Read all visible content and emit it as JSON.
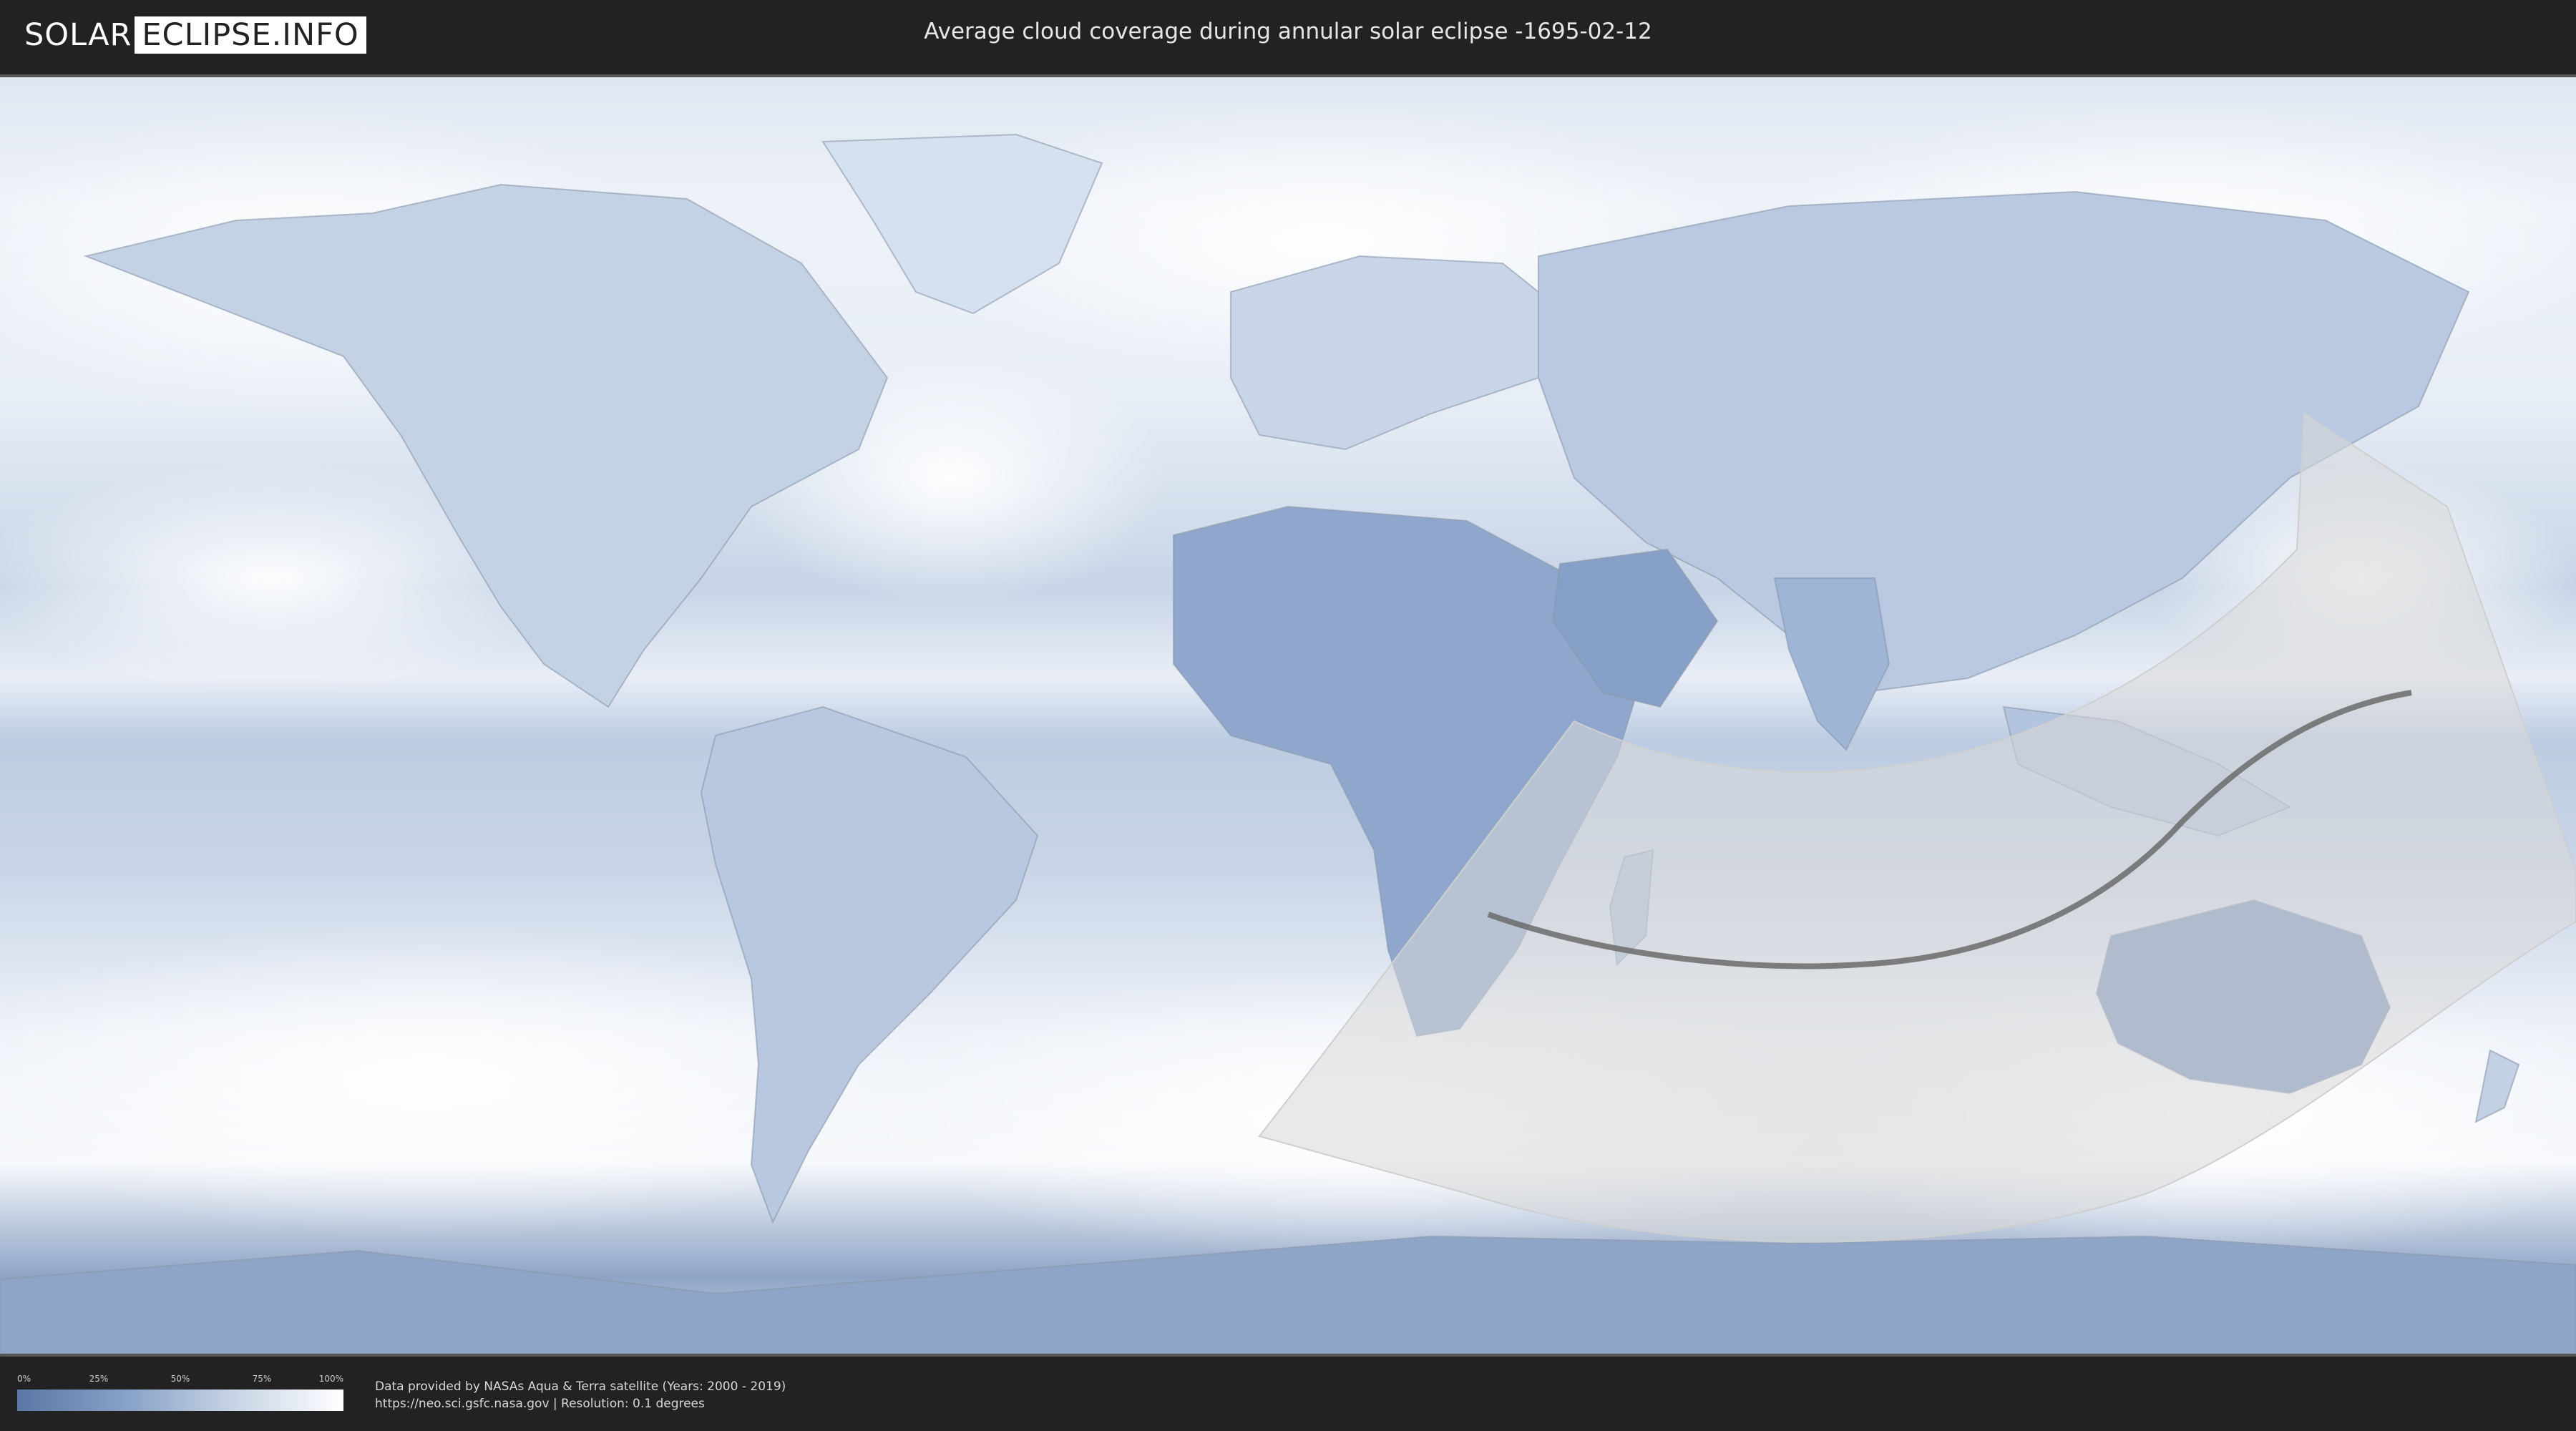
{
  "header": {
    "logo_part1": "SOLAR",
    "logo_part2": "ECLIPSE.INFO",
    "title": "Average cloud coverage during annular solar eclipse -1695-02-12"
  },
  "legend": {
    "ticks": [
      "0%",
      "25%",
      "50%",
      "75%",
      "100%"
    ],
    "colors": {
      "low": "#5b77a6",
      "high": "#ffffff"
    }
  },
  "footer": {
    "credit_line1": "Data provided by NASAs Aqua & Terra satellite (Years: 2000 - 2019)",
    "credit_line2": "https://neo.sci.gsfc.nasa.gov | Resolution: 0.1 degrees"
  },
  "map": {
    "ocean_color": "#cfd9e6",
    "cloud_color": "#f4f7fb",
    "land_dark_color": "#7d96bf",
    "eclipse_zone_color": "#d9d9d9",
    "central_line_color": "#6b6b6b"
  }
}
